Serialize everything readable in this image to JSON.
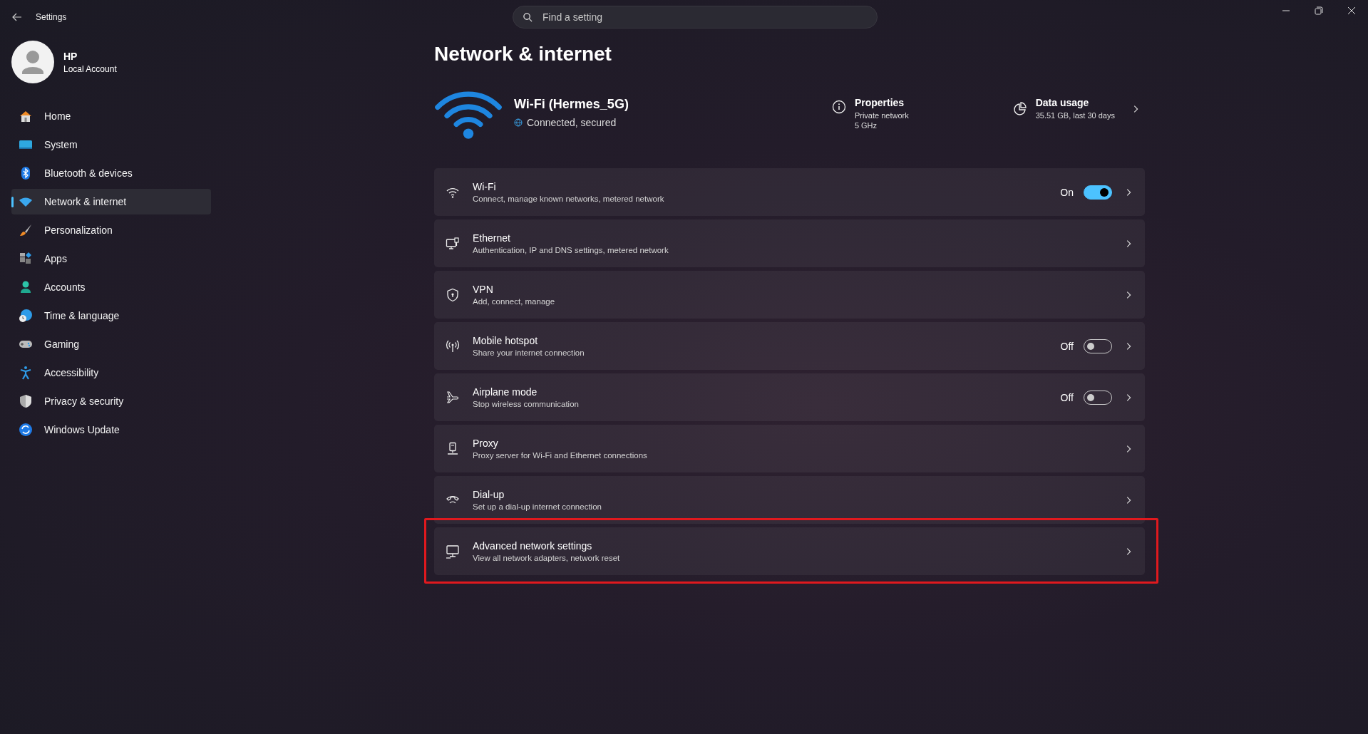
{
  "window": {
    "title": "Settings"
  },
  "search": {
    "placeholder": "Find a setting"
  },
  "account": {
    "name": "HP",
    "type": "Local Account"
  },
  "sidebar": {
    "items": [
      {
        "label": "Home",
        "selected": false
      },
      {
        "label": "System",
        "selected": false
      },
      {
        "label": "Bluetooth & devices",
        "selected": false
      },
      {
        "label": "Network & internet",
        "selected": true
      },
      {
        "label": "Personalization",
        "selected": false
      },
      {
        "label": "Apps",
        "selected": false
      },
      {
        "label": "Accounts",
        "selected": false
      },
      {
        "label": "Time & language",
        "selected": false
      },
      {
        "label": "Gaming",
        "selected": false
      },
      {
        "label": "Accessibility",
        "selected": false
      },
      {
        "label": "Privacy & security",
        "selected": false
      },
      {
        "label": "Windows Update",
        "selected": false
      }
    ]
  },
  "page": {
    "title": "Network & internet"
  },
  "connection": {
    "name": "Wi-Fi (Hermes_5G)",
    "status": "Connected, secured",
    "properties": {
      "title": "Properties",
      "lines": [
        "Private network",
        "5 GHz"
      ]
    },
    "data_usage": {
      "title": "Data usage",
      "detail": "35.51 GB, last 30 days"
    }
  },
  "rows": [
    {
      "kind": "toggle",
      "title": "Wi-Fi",
      "subtitle": "Connect, manage known networks, metered network",
      "state_label": "On",
      "on": true,
      "highlighted": false
    },
    {
      "kind": "link",
      "title": "Ethernet",
      "subtitle": "Authentication, IP and DNS settings, metered network",
      "highlighted": false
    },
    {
      "kind": "link",
      "title": "VPN",
      "subtitle": "Add, connect, manage",
      "highlighted": false
    },
    {
      "kind": "toggle",
      "title": "Mobile hotspot",
      "subtitle": "Share your internet connection",
      "state_label": "Off",
      "on": false,
      "highlighted": false
    },
    {
      "kind": "toggle",
      "title": "Airplane mode",
      "subtitle": "Stop wireless communication",
      "state_label": "Off",
      "on": false,
      "highlighted": false
    },
    {
      "kind": "link",
      "title": "Proxy",
      "subtitle": "Proxy server for Wi-Fi and Ethernet connections",
      "highlighted": false
    },
    {
      "kind": "link",
      "title": "Dial-up",
      "subtitle": "Set up a dial-up internet connection",
      "highlighted": false
    },
    {
      "kind": "link",
      "title": "Advanced network settings",
      "subtitle": "View all network adapters, network reset",
      "highlighted": true
    }
  ]
}
